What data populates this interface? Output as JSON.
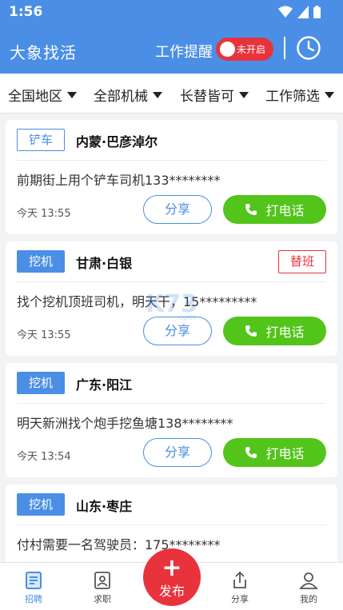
{
  "statusbar": {
    "time": "1:56"
  },
  "appbar": {
    "title": "大象找活",
    "remind_label": "工作提醒",
    "toggle_label": "未开启"
  },
  "filters": [
    "全国地区",
    "全部机械",
    "长替皆可",
    "工作筛选"
  ],
  "cards": [
    {
      "tag": "铲车",
      "location": "内蒙·巴彦淖尔",
      "subtag": "",
      "description": "前期街上用个铲车司机133********",
      "time": "今天 13:55",
      "share": "分享",
      "call": "打电话"
    },
    {
      "tag": "挖机",
      "location": "甘肃·白银",
      "subtag": "替班",
      "description": "找个挖机顶班司机，明天干，15*********",
      "time": "今天 13:55",
      "share": "分享",
      "call": "打电话"
    },
    {
      "tag": "挖机",
      "location": "广东·阳江",
      "subtag": "",
      "description": "明天新洲找个炮手挖鱼塘138********",
      "time": "今天 13:54",
      "share": "分享",
      "call": "打电话"
    },
    {
      "tag": "挖机",
      "location": "山东·枣庄",
      "subtag": "",
      "description": "付村需要一名驾驶员：175********",
      "time": "",
      "share": "",
      "call": ""
    }
  ],
  "tabbar": {
    "items": [
      "招聘",
      "求职",
      "分享",
      "我的"
    ],
    "fab_label": "发布"
  },
  "colors": {
    "primary": "#4a8ee6",
    "red": "#e8333d",
    "green": "#52c41a"
  }
}
